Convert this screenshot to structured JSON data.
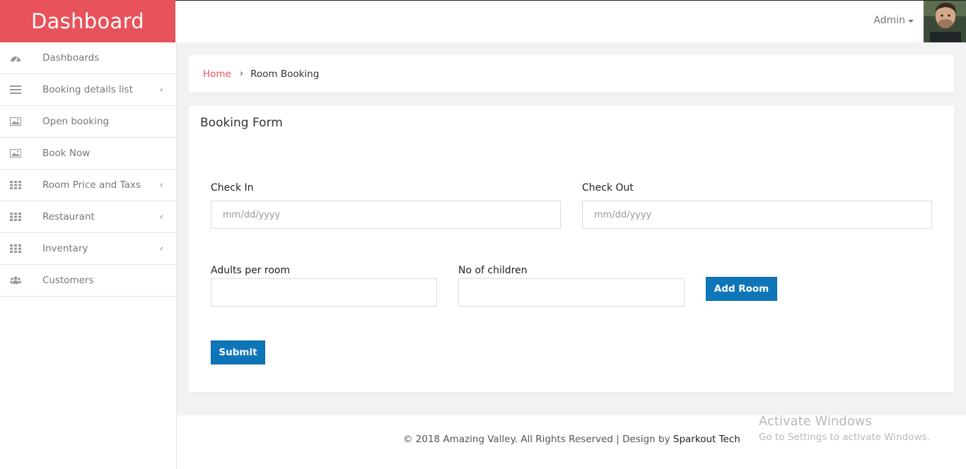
{
  "brand": {
    "title": "Dashboard"
  },
  "header": {
    "user_label": "Admin"
  },
  "sidebar": {
    "items": [
      {
        "label": "Dashboards",
        "icon": "dashboard-icon",
        "has_submenu": false
      },
      {
        "label": "Booking details list",
        "icon": "list-icon",
        "has_submenu": true
      },
      {
        "label": "Open booking",
        "icon": "image-icon",
        "has_submenu": false
      },
      {
        "label": "Book Now",
        "icon": "image-icon",
        "has_submenu": false
      },
      {
        "label": "Room Price and Taxs",
        "icon": "grid-icon",
        "has_submenu": true
      },
      {
        "label": "Restaurant",
        "icon": "grid-icon",
        "has_submenu": true
      },
      {
        "label": "Inventary",
        "icon": "grid-icon",
        "has_submenu": true
      },
      {
        "label": "Customers",
        "icon": "users-icon",
        "has_submenu": false
      }
    ],
    "chevron": "‹"
  },
  "breadcrumb": {
    "home": "Home",
    "separator": "›",
    "current": "Room Booking"
  },
  "form": {
    "title": "Booking Form",
    "check_in": {
      "label": "Check In",
      "placeholder": "mm/dd/yyyy",
      "value": ""
    },
    "check_out": {
      "label": "Check Out",
      "placeholder": "mm/dd/yyyy",
      "value": ""
    },
    "adults": {
      "label": "Adults per room",
      "value": ""
    },
    "children": {
      "label": "No of children",
      "value": ""
    },
    "add_room_label": "Add Room",
    "submit_label": "Submit"
  },
  "footer": {
    "text": "© 2018 Amazing Valley. All Rights Reserved | Design by ",
    "company": "Sparkout Tech"
  },
  "watermark": {
    "line1": "Activate Windows",
    "line2": "Go to Settings to activate Windows."
  },
  "colors": {
    "brand": "#e8525a",
    "button": "#0e76b8",
    "background": "#f1f2f4"
  }
}
